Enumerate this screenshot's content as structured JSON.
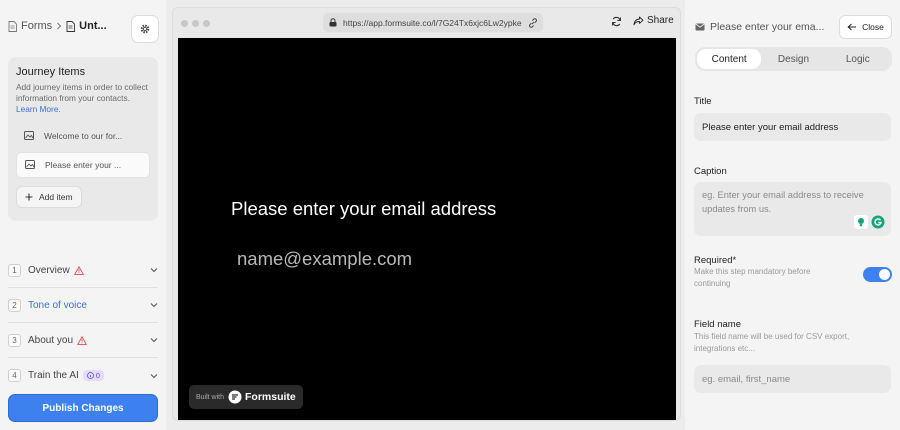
{
  "sidebar": {
    "breadcrumb": {
      "root": "Forms",
      "current": "Unt..."
    },
    "journey": {
      "title": "Journey Items",
      "description": "Add journey items in order to collect information from your contacts.",
      "learn_more": "Learn More.",
      "items": [
        {
          "label": "Welcome to our for..."
        },
        {
          "label": "Please enter your ..."
        }
      ],
      "add_label": "Add item"
    },
    "steps": [
      {
        "num": "1",
        "label": "Overview",
        "warning": true
      },
      {
        "num": "2",
        "label": "Tone of voice",
        "warning": false
      },
      {
        "num": "3",
        "label": "About you",
        "warning": true
      },
      {
        "num": "4",
        "label": "Train the AI",
        "warning": false,
        "badge": "0"
      }
    ],
    "publish_label": "Publish Changes"
  },
  "browser": {
    "url": "https://app.formsuite.co/l/7G24Tx6xjc6Lw2ypke",
    "share_label": "Share",
    "preview": {
      "title": "Please enter your email address",
      "input_placeholder": "name@example.com",
      "built_with": "Built with",
      "brand": "Formsuite"
    }
  },
  "panel": {
    "header": "Please enter your ema...",
    "close_label": "Close",
    "tabs": [
      {
        "label": "Content",
        "active": true
      },
      {
        "label": "Design",
        "active": false
      },
      {
        "label": "Logic",
        "active": false
      }
    ],
    "title_label": "Title",
    "title_value": "Please enter your email address",
    "caption_label": "Caption",
    "caption_placeholder": "eg. Enter your email address to receive updates from us.",
    "required_label": "Required*",
    "required_help": "Make this step mandatory before continuing",
    "required_on": true,
    "field_name_label": "Field name",
    "field_name_help": "This field name will be used for CSV export, integrations etc...",
    "field_name_placeholder": "eg. email, first_name"
  },
  "colors": {
    "accent": "#3d80f0",
    "warning": "#e5484d",
    "link": "#3b6fd6"
  }
}
